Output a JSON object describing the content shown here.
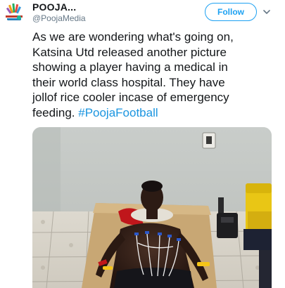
{
  "tweet": {
    "user": {
      "display_name": "POOJA...",
      "handle": "@PoojaMedia"
    },
    "follow_label": "Follow",
    "text_lines": [
      "As we are wondering what's going on,",
      "Katsina Utd released another picture",
      "showing a player having a medical in",
      "their world class hospital. They have",
      "jollof rice cooler incase of emergency"
    ],
    "last_line_prefix": "feeding. ",
    "hashtag": "#PoojaFootball"
  },
  "colors": {
    "brand_blue": "#1da1f2",
    "hashtag_blue": "#1b95e0",
    "muted_text": "#657786"
  },
  "icons": {
    "menu": "chevron-down-icon"
  }
}
